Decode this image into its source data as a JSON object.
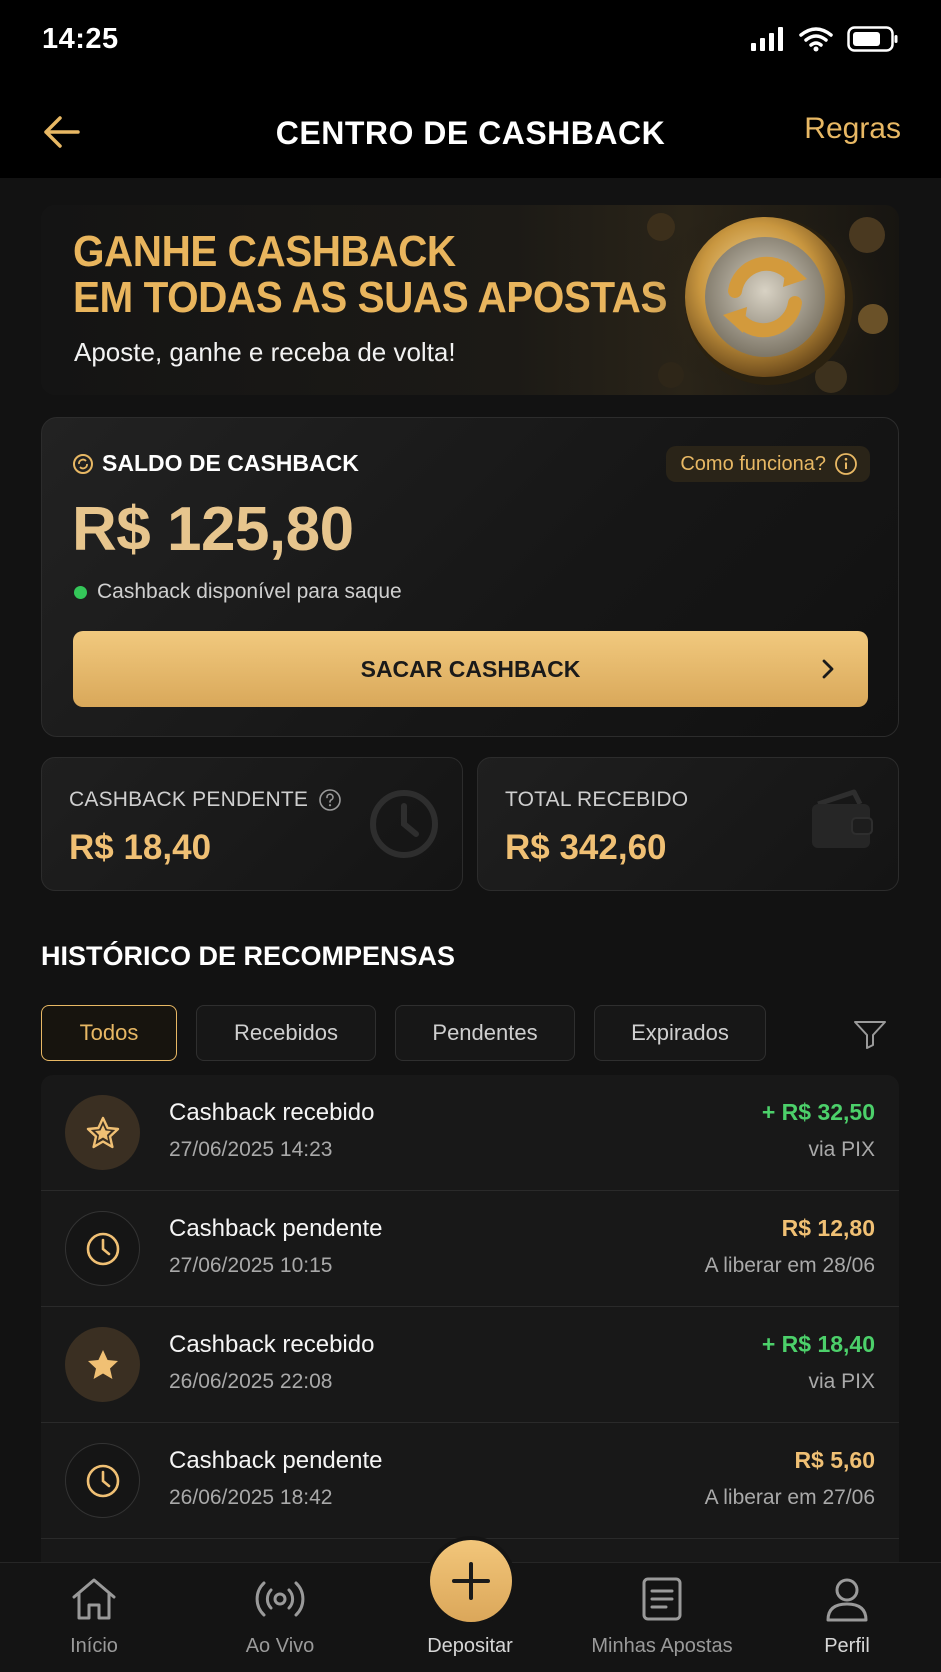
{
  "status_bar": {
    "time": "14:25"
  },
  "header": {
    "title": "CENTRO DE CASHBACK",
    "rules_label": "Regras"
  },
  "banner": {
    "headline_line1": "GANHE CASHBACK",
    "headline_line2": "EM TODAS AS SUAS APOSTAS",
    "subtitle": "Aposte, ganhe e receba de volta!"
  },
  "balance": {
    "label": "SALDO DE CASHBACK",
    "how_it_works": "Como funciona?",
    "value": "R$ 125,80",
    "availability": "Cashback disponível para saque",
    "withdraw_label": "SACAR CASHBACK"
  },
  "stats": {
    "pending_label": "CASHBACK PENDENTE",
    "pending_value": "R$ 18,40",
    "total_label": "TOTAL RECEBIDO",
    "total_value": "R$ 342,60"
  },
  "history": {
    "title": "HISTÓRICO DE RECOMPENSAS",
    "filters": [
      "Todos",
      "Recebidos",
      "Pendentes",
      "Expirados"
    ],
    "active_filter": "Todos",
    "rows": [
      {
        "icon": "star-icon",
        "title": "Cashback recebido",
        "date": "27/06/2025 14:23",
        "amount": "+ R$ 32,50",
        "sub": "via PIX",
        "status": "received"
      },
      {
        "icon": "clock-icon",
        "title": "Cashback pendente",
        "date": "27/06/2025 10:15",
        "amount": "R$ 12,80",
        "sub": "A liberar em 28/06",
        "status": "pending"
      },
      {
        "icon": "star-icon",
        "title": "Cashback recebido",
        "date": "26/06/2025 22:08",
        "amount": "+ R$ 18,40",
        "sub": "via PIX",
        "status": "received"
      },
      {
        "icon": "clock-icon",
        "title": "Cashback pendente",
        "date": "26/06/2025 18:42",
        "amount": "R$ 5,60",
        "sub": "A liberar em 27/06",
        "status": "pending"
      }
    ]
  },
  "bottom_nav": {
    "items": [
      {
        "label": "Início",
        "icon": "home-icon"
      },
      {
        "label": "Ao Vivo",
        "icon": "broadcast-icon"
      },
      {
        "label": "Depositar",
        "icon": "plus-icon"
      },
      {
        "label": "Minhas Apostas",
        "icon": "bet-slip-icon"
      },
      {
        "label": "Perfil",
        "icon": "user-icon"
      }
    ]
  },
  "colors": {
    "accent_gold": "#e8b864",
    "positive_green": "#4cd06a",
    "background": "#121212"
  }
}
